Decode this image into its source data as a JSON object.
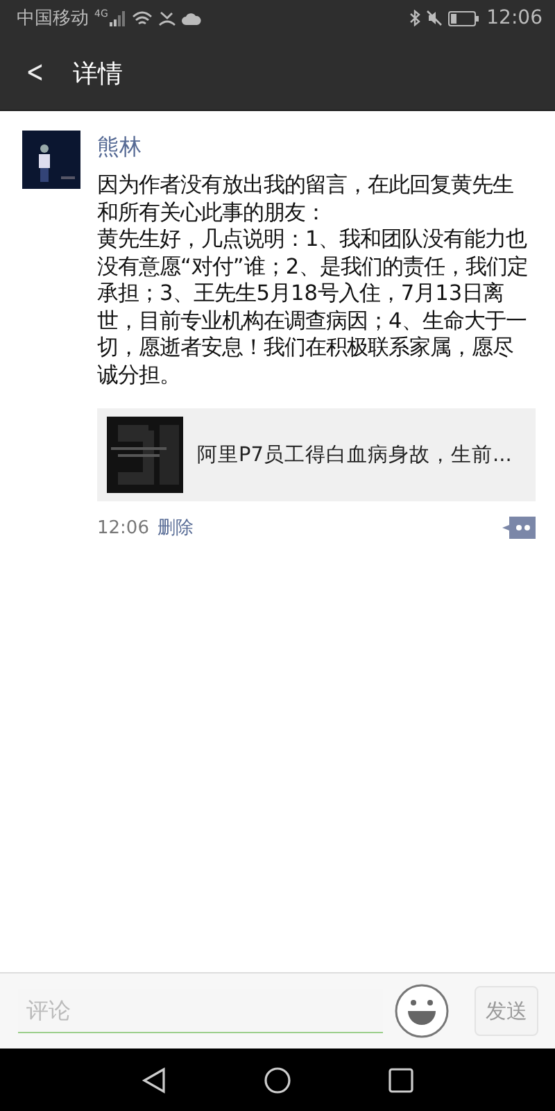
{
  "status_bar": {
    "carrier": "中国移动",
    "network": "4G",
    "time": "12:06"
  },
  "header": {
    "back": "<",
    "title": "详情"
  },
  "post": {
    "author": "熊林",
    "paragraphs": [
      "因为作者没有放出我的留言，在此回复黄先生和所有关心此事的朋友：",
      "黄先生好，几点说明：1、我和团队没有能力也没有意愿“对付”谁；2、是我们的责任，我们定承担；3、王先生5月18号入住，7月13日离世，目前专业机构在调查病因；4、生命大于一切，愿逝者安息！我们在积极联系家属，愿尽诚分担。"
    ],
    "link": {
      "title": "阿里P7员工得白血病身故，生前..."
    },
    "time": "12:06",
    "delete": "删除"
  },
  "composer": {
    "placeholder": "评论",
    "send": {
      "label": "发送",
      "disabled": true
    }
  }
}
